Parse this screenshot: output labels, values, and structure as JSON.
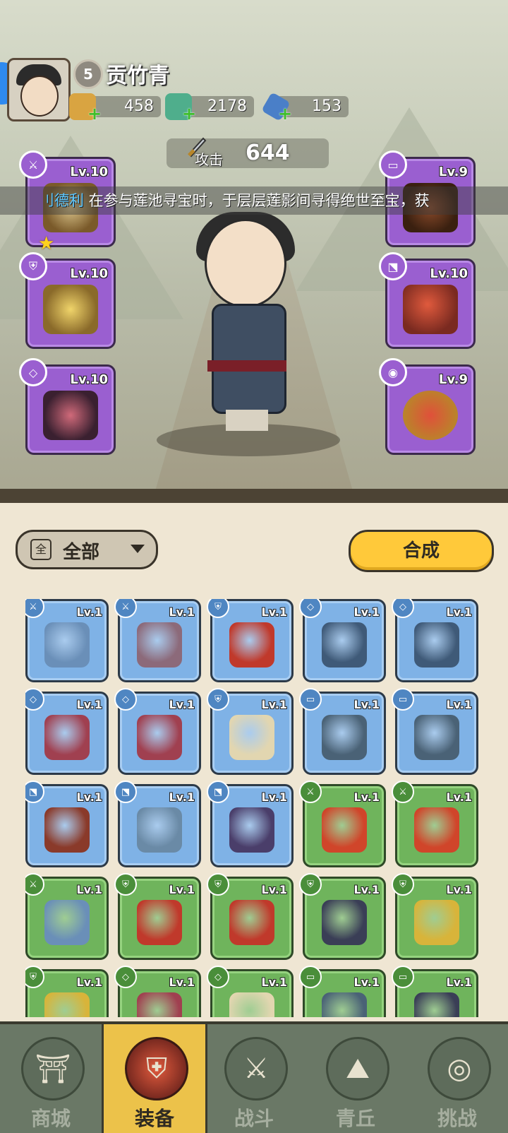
{
  "player": {
    "level": "5",
    "name": "贡竹青"
  },
  "resources": [
    {
      "name": "gold-pouch-icon",
      "value": "458"
    },
    {
      "name": "jade-dragon-icon",
      "value": "2178"
    },
    {
      "name": "crystal-icon",
      "value": "153"
    }
  ],
  "attack": {
    "label": "攻击",
    "value": "644"
  },
  "ticker": {
    "player": "刂德利",
    "message": " 在参与莲池寻宝时，于层层莲影间寻得绝世至宝，获"
  },
  "equipped_left": [
    {
      "type": "weapon",
      "type_glyph": "⚔",
      "level": "Lv.10",
      "starred": true,
      "star": "★"
    },
    {
      "type": "armor",
      "type_glyph": "⛨",
      "level": "Lv.10"
    },
    {
      "type": "bracer",
      "type_glyph": "◇",
      "level": "Lv.10"
    }
  ],
  "equipped_right": [
    {
      "type": "belt",
      "type_glyph": "▭",
      "level": "Lv.9"
    },
    {
      "type": "boots",
      "type_glyph": "⬔",
      "level": "Lv.10"
    },
    {
      "type": "accessory",
      "type_glyph": "◉",
      "level": "Lv.9"
    }
  ],
  "filter": {
    "icon_char": "全",
    "label": "全部"
  },
  "synthesize_label": "合成",
  "inventory": [
    {
      "rarity": "blue",
      "type": "weapon",
      "item": "bow",
      "glyph": "⚔",
      "level": "Lv.1",
      "color": "#6a8fb8"
    },
    {
      "rarity": "blue",
      "type": "weapon",
      "item": "hammer",
      "glyph": "⚔",
      "level": "Lv.1",
      "color": "#8c6a7a"
    },
    {
      "rarity": "blue",
      "type": "armor",
      "item": "red-helm",
      "glyph": "⛨",
      "level": "Lv.1",
      "color": "#c0392b"
    },
    {
      "rarity": "blue",
      "type": "bracer",
      "item": "ice-bracer",
      "glyph": "◇",
      "level": "Lv.1",
      "color": "#3f5a78"
    },
    {
      "rarity": "blue",
      "type": "bracer",
      "item": "ice-bracer",
      "glyph": "◇",
      "level": "Lv.1",
      "color": "#3f5a78"
    },
    {
      "rarity": "blue",
      "type": "bracer",
      "item": "red-bracer",
      "glyph": "◇",
      "level": "Lv.1",
      "color": "#a04050"
    },
    {
      "rarity": "blue",
      "type": "bracer",
      "item": "red-bracer",
      "glyph": "◇",
      "level": "Lv.1",
      "color": "#a04050"
    },
    {
      "rarity": "blue",
      "type": "armor",
      "item": "bone-armor",
      "glyph": "⛨",
      "level": "Lv.1",
      "color": "#e2d6b0"
    },
    {
      "rarity": "blue",
      "type": "belt",
      "item": "ice-belt",
      "glyph": "▭",
      "level": "Lv.1",
      "color": "#4a6276"
    },
    {
      "rarity": "blue",
      "type": "belt",
      "item": "ice-belt",
      "glyph": "▭",
      "level": "Lv.1",
      "color": "#4a6276"
    },
    {
      "rarity": "blue",
      "type": "boots",
      "item": "red-boots",
      "glyph": "⬔",
      "level": "Lv.1",
      "color": "#8a3a2a"
    },
    {
      "rarity": "blue",
      "type": "boots",
      "item": "ice-boots",
      "glyph": "⬔",
      "level": "Lv.1",
      "color": "#6a8aa6"
    },
    {
      "rarity": "blue",
      "type": "boots",
      "item": "violet-boots",
      "glyph": "⬔",
      "level": "Lv.1",
      "color": "#4a3e6a"
    },
    {
      "rarity": "green",
      "type": "weapon",
      "item": "flame-staff",
      "glyph": "⚔",
      "level": "Lv.1",
      "color": "#d0452a"
    },
    {
      "rarity": "green",
      "type": "weapon",
      "item": "flame-staff",
      "glyph": "⚔",
      "level": "Lv.1",
      "color": "#d0452a"
    },
    {
      "rarity": "green",
      "type": "weapon",
      "item": "bow",
      "glyph": "⚔",
      "level": "Lv.1",
      "color": "#6a8fb8"
    },
    {
      "rarity": "green",
      "type": "armor",
      "item": "red-helm",
      "glyph": "⛨",
      "level": "Lv.1",
      "color": "#c0392b"
    },
    {
      "rarity": "green",
      "type": "armor",
      "item": "red-helm",
      "glyph": "⛨",
      "level": "Lv.1",
      "color": "#c0392b"
    },
    {
      "rarity": "green",
      "type": "armor",
      "item": "dark-armor",
      "glyph": "⛨",
      "level": "Lv.1",
      "color": "#3a3e56"
    },
    {
      "rarity": "green",
      "type": "armor",
      "item": "gold-armor",
      "glyph": "⛨",
      "level": "Lv.1",
      "color": "#d8b43a"
    },
    {
      "rarity": "green",
      "type": "armor",
      "item": "gold-armor",
      "glyph": "⛨",
      "level": "Lv.1",
      "color": "#d8b43a"
    },
    {
      "rarity": "green",
      "type": "bracer",
      "item": "red-bracer",
      "glyph": "◇",
      "level": "Lv.1",
      "color": "#a04050"
    },
    {
      "rarity": "green",
      "type": "bracer",
      "item": "bone-armor",
      "glyph": "◇",
      "level": "Lv.1",
      "color": "#e2d6b0"
    },
    {
      "rarity": "green",
      "type": "belt",
      "item": "ice-belt",
      "glyph": "▭",
      "level": "Lv.1",
      "color": "#4a6276"
    },
    {
      "rarity": "green",
      "type": "belt",
      "item": "dark-belt",
      "glyph": "▭",
      "level": "Lv.1",
      "color": "#3a3e56"
    }
  ],
  "nav": [
    {
      "label": "商城",
      "icon": "shop-icon",
      "glyph": "⛩",
      "active": false
    },
    {
      "label": "装备",
      "icon": "equipment-helmet-icon",
      "glyph": "⛨",
      "active": true
    },
    {
      "label": "战斗",
      "icon": "crossed-swords-icon",
      "glyph": "⚔",
      "active": false
    },
    {
      "label": "青丘",
      "icon": "mountain-icon",
      "glyph": "⛰",
      "active": false
    },
    {
      "label": "挑战",
      "icon": "challenge-orb-icon",
      "glyph": "◎",
      "active": false
    }
  ],
  "colors": {
    "epic_purple": "#9a5fd0",
    "rare_blue": "#7fb2e6",
    "uncommon_green": "#6fb45c",
    "synth_yellow": "#ffc93a",
    "nav_active": "#ecc24a"
  }
}
